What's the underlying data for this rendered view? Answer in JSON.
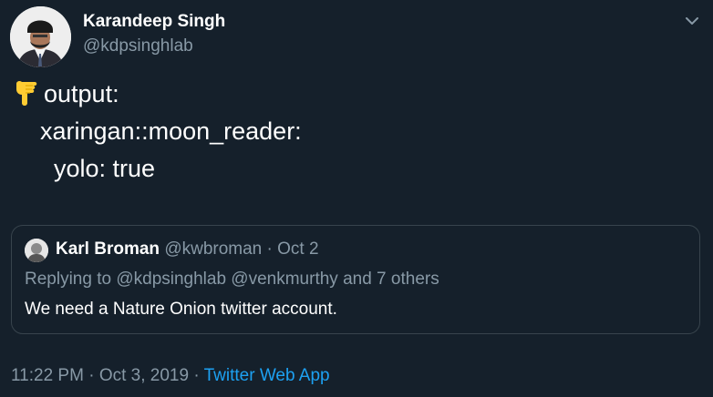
{
  "tweet": {
    "author_name": "Karandeep Singh",
    "author_handle": "@kdpsinghlab",
    "lines": [
      "output:",
      "    xaringan::moon_reader:",
      "      yolo: true"
    ],
    "emoji_icon": "pointing-down-hand-icon"
  },
  "quote": {
    "author_name": "Karl Broman",
    "author_handle": "@kwbroman",
    "separator": "·",
    "date": "Oct 2",
    "replying_to": "Replying to @kdpsinghlab @venkmurthy and 7 others",
    "text": "We need a Nature Onion twitter account."
  },
  "footer": {
    "time": "11:22 PM",
    "separator": "·",
    "date": "Oct 3, 2019",
    "app": "Twitter Web App"
  },
  "colors": {
    "background": "#15202b",
    "secondary_text": "#8899a6",
    "accent": "#1da1f2",
    "border": "#38444d"
  }
}
